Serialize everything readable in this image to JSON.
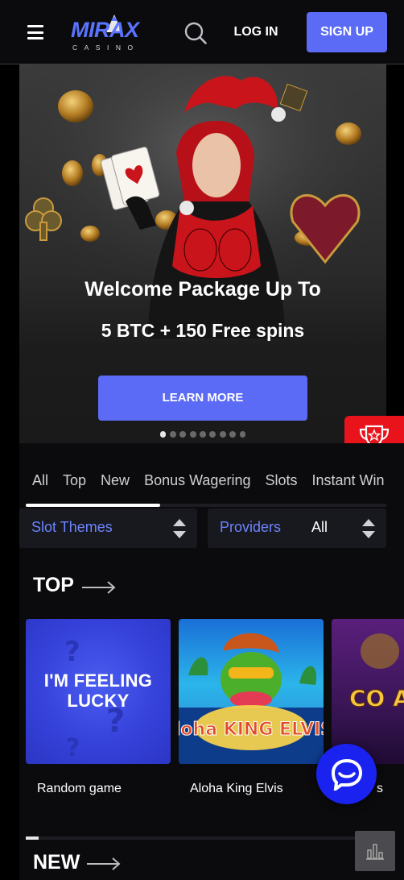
{
  "header": {
    "logo_text": "MIRAX",
    "logo_subtext": "CASINO",
    "login_label": "LOG IN",
    "signup_label": "SIGN UP"
  },
  "hero": {
    "title": "Welcome Package Up To",
    "subtitle": "5 BTC + 150 Free spins",
    "cta_label": "LEARN MORE",
    "slide_count": 9,
    "active_slide": 1
  },
  "tabs": [
    {
      "label": "All"
    },
    {
      "label": "Top"
    },
    {
      "label": "New"
    },
    {
      "label": "Bonus Wagering"
    },
    {
      "label": "Slots"
    },
    {
      "label": "Instant Win"
    }
  ],
  "filters": {
    "themes_label": "Slot Themes",
    "providers_label": "Providers",
    "providers_value": "All"
  },
  "sections": {
    "top_title": "TOP",
    "new_title": "NEW"
  },
  "top_games": [
    {
      "name": "Random game",
      "thumb_text": "I'M FEELING LUCKY"
    },
    {
      "name": "Aloha King Elvis",
      "thumb_text": "Aloha KING ELVIS!"
    },
    {
      "name": "s",
      "thumb_text": "CO AL H"
    }
  ],
  "colors": {
    "accent": "#5b6bf5",
    "accent_text": "#6b84ff",
    "trophy_bg": "#e9131b",
    "chat_bg": "#1a22f0"
  },
  "icons": {
    "menu": "hamburger-icon",
    "search": "search-icon",
    "trophy": "trophy-icon",
    "chat": "chat-icon",
    "stats": "bar-chart-icon",
    "arrow": "arrow-right-icon",
    "sort": "sort-arrows-icon"
  }
}
